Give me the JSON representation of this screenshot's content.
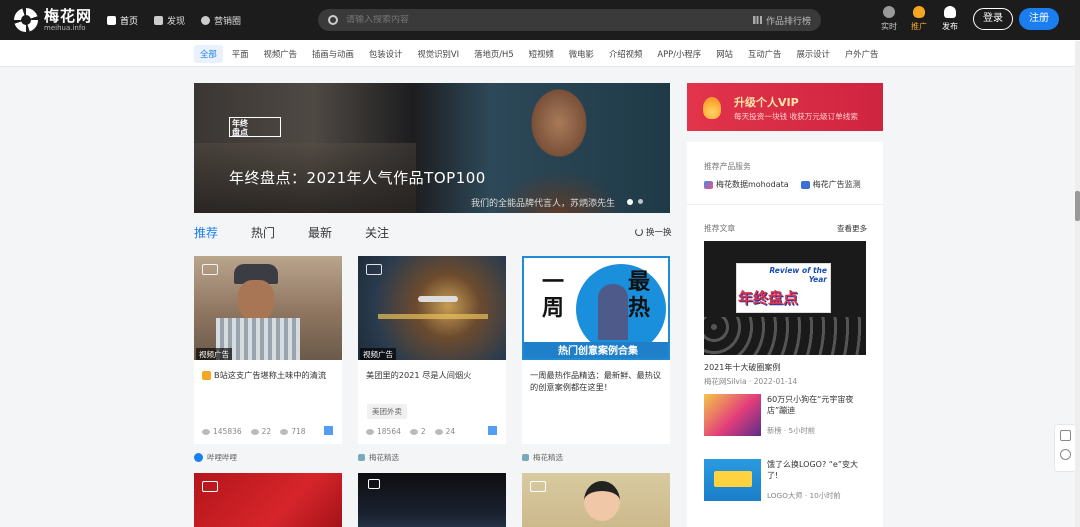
{
  "site": {
    "name_cn": "梅花网",
    "name_en": "meihua.info"
  },
  "nav": [
    {
      "label": "首页",
      "icon": "home-icon"
    },
    {
      "label": "发现",
      "icon": "grid-icon"
    },
    {
      "label": "营销圈",
      "icon": "compass-icon"
    }
  ],
  "search": {
    "placeholder": "请输入搜索内容",
    "rank_label": "作品排行榜"
  },
  "header_actions": [
    {
      "label": "实时",
      "icon": "live-icon",
      "color": "#cccccc"
    },
    {
      "label": "推广",
      "icon": "flame-icon",
      "color": "#f5a623"
    },
    {
      "label": "发布",
      "icon": "cloud-upload-icon",
      "color": "#ffffff"
    }
  ],
  "auth": {
    "login": "登录",
    "register": "注册"
  },
  "categories": [
    "全部",
    "平面",
    "视频广告",
    "插画与动画",
    "包装设计",
    "视觉识别VI",
    "落地页/H5",
    "短视频",
    "微电影",
    "介绍视频",
    "APP/小程序",
    "网站",
    "互动广告",
    "展示设计",
    "户外广告"
  ],
  "banner": {
    "badge": "年终盘点 Review of the Year",
    "badge_line1": "年终",
    "badge_line2": "盘点",
    "title": "年终盘点：2021年人气作品TOP100",
    "subtitle": "我们的全能品牌代言人，苏炳添先生"
  },
  "feed_tabs": [
    "推荐",
    "热门",
    "最新",
    "关注"
  ],
  "refresh_label": "换一换",
  "cards": [
    {
      "tag": "视频广告",
      "title": "B站这支广告堪称土味中的清流",
      "views": "145836",
      "comments": "22",
      "likes": "718",
      "author": "哔哩哔哩"
    },
    {
      "tag": "视频广告",
      "title": "美团里的2021 尽是人间烟火",
      "keyword": "美团外卖",
      "views": "18564",
      "comments": "2",
      "likes": "24",
      "author": "梅花精选"
    },
    {
      "tag": "",
      "title": "一周最热作品精选：最新鲜、最热议的创意案例都在这里！",
      "author": "梅花精选",
      "img_text": "热门创意案例合集",
      "img_big1": "一",
      "img_big2": "周",
      "img_big3": "最",
      "img_big4": "热"
    }
  ],
  "vip": {
    "title": "升级个人VIP",
    "subtitle": "每天投资一块钱 收获万元级订单线索"
  },
  "sidebar": {
    "services_label": "推荐产品服务",
    "services": [
      "梅花数据mohodata",
      "梅花广告监测"
    ],
    "articles_label": "推荐文章",
    "more": "查看更多",
    "featured": {
      "title": "2021年十大破圈案例",
      "meta": "梅花网Silvia · 2022-01-14",
      "img_top": "Review of the Year",
      "img_big": "年终盘点"
    },
    "items": [
      {
        "title": "60万只小狗在“元宇宙夜店”蹦迪",
        "meta": "新榜 · 5小时前"
      },
      {
        "title": "饿了么换LOGO? “e”变大了!",
        "meta": "LOGO大师 · 10小时前"
      }
    ]
  }
}
